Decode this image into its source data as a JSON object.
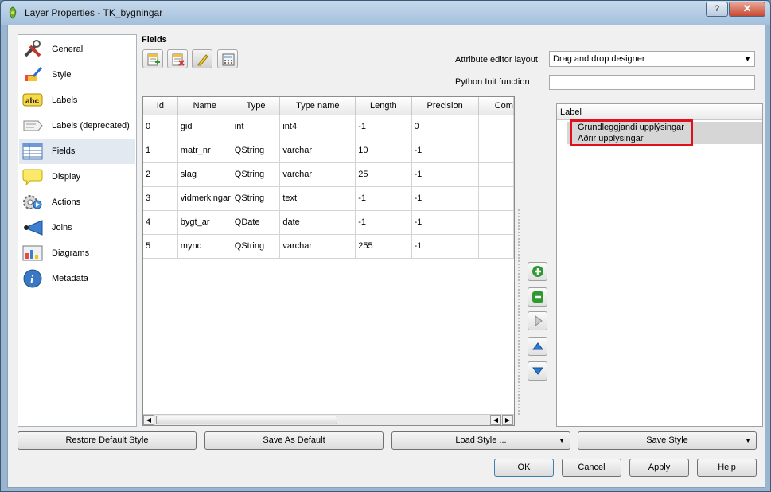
{
  "window": {
    "title": "Layer Properties - TK_bygningar",
    "close_label": "✕",
    "help_label": "?"
  },
  "sidebar": {
    "items": [
      {
        "label": "General",
        "icon": "tools-icon"
      },
      {
        "label": "Style",
        "icon": "paintbrush-icon"
      },
      {
        "label": "Labels",
        "icon": "abc-labels-icon"
      },
      {
        "label": "Labels (deprecated)",
        "icon": "labels-deprecated-icon"
      },
      {
        "label": "Fields",
        "icon": "table-icon"
      },
      {
        "label": "Display",
        "icon": "speech-bubble-icon"
      },
      {
        "label": "Actions",
        "icon": "gear-actions-icon"
      },
      {
        "label": "Joins",
        "icon": "joins-arrow-icon"
      },
      {
        "label": "Diagrams",
        "icon": "diagram-icon"
      },
      {
        "label": "Metadata",
        "icon": "info-icon"
      }
    ],
    "active": "Fields"
  },
  "fields": {
    "title": "Fields",
    "toolbar": [
      "new-field-icon",
      "delete-field-icon",
      "edit-pencil-icon",
      "field-calculator-icon"
    ],
    "attribute_editor_label": "Attribute editor layout:",
    "attribute_editor_value": "Drag and drop designer",
    "python_init_label": "Python Init function",
    "python_init_value": "",
    "columns": [
      "Id",
      "Name",
      "Type",
      "Type name",
      "Length",
      "Precision",
      "Com"
    ],
    "rows": [
      [
        "0",
        "gid",
        "int",
        "int4",
        "-1",
        "0",
        ""
      ],
      [
        "1",
        "matr_nr",
        "QString",
        "varchar",
        "10",
        "-1",
        ""
      ],
      [
        "2",
        "slag",
        "QString",
        "varchar",
        "25",
        "-1",
        ""
      ],
      [
        "3",
        "vidmerkingar",
        "QString",
        "text",
        "-1",
        "-1",
        ""
      ],
      [
        "4",
        "bygt_ar",
        "QDate",
        "date",
        "-1",
        "-1",
        ""
      ],
      [
        "5",
        "mynd",
        "QString",
        "varchar",
        "255",
        "-1",
        ""
      ]
    ]
  },
  "designer": {
    "header": "Label",
    "items": [
      "Grundleggjandi upplýsingar",
      "Aðrir upplýsingar"
    ],
    "buttons": [
      "add-icon",
      "remove-icon",
      "move-right-icon",
      "move-up-icon",
      "move-down-icon"
    ]
  },
  "bottom": {
    "restore_default": "Restore Default Style",
    "save_as_default": "Save As Default",
    "load_style": "Load Style ...",
    "save_style": "Save Style",
    "ok": "OK",
    "cancel": "Cancel",
    "apply": "Apply",
    "help": "Help"
  },
  "colors": {
    "highlight": "#e0101c",
    "accent_green": "#2e9a2e",
    "accent_blue": "#2a7ad0"
  }
}
